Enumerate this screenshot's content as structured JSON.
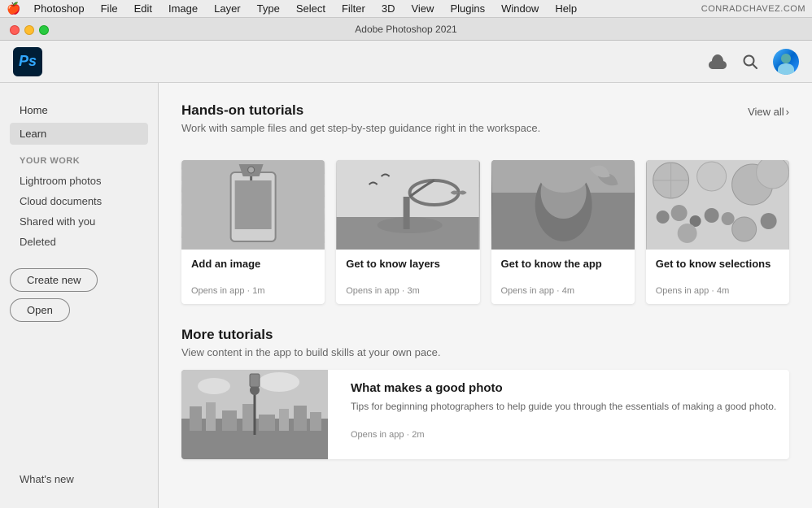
{
  "menubar": {
    "apple": "🍎",
    "app_name": "Photoshop",
    "items": [
      "File",
      "Edit",
      "Image",
      "Layer",
      "Type",
      "Select",
      "Filter",
      "3D",
      "View",
      "Plugins",
      "Window",
      "Help"
    ],
    "right_text": "CONRADCHAVEZ.COM"
  },
  "titlebar": {
    "title": "Adobe Photoshop 2021"
  },
  "header": {
    "logo_text": "Ps",
    "cloud_icon": "☁",
    "search_icon": "🔍"
  },
  "sidebar": {
    "nav_home": "Home",
    "nav_learn": "Learn",
    "your_work_label": "YOUR WORK",
    "nav_lightroom": "Lightroom photos",
    "nav_cloud": "Cloud documents",
    "nav_shared": "Shared with you",
    "nav_deleted": "Deleted",
    "btn_create": "Create new",
    "btn_open": "Open",
    "whats_new": "What's new"
  },
  "main": {
    "tutorials_title": "Hands-on tutorials",
    "tutorials_subtitle": "Work with sample files and get step-by-step guidance right in the workspace.",
    "view_all": "View all",
    "cards": [
      {
        "title": "Add an image",
        "meta": "Opens in app · 1m",
        "img_class": "card-img-1"
      },
      {
        "title": "Get to know layers",
        "meta": "Opens in app · 3m",
        "img_class": "card-img-2"
      },
      {
        "title": "Get to know the app",
        "meta": "Opens in app · 4m",
        "img_class": "card-img-3"
      },
      {
        "title": "Get to know selections",
        "meta": "Opens in app · 4m",
        "img_class": "card-img-4"
      }
    ],
    "more_title": "More tutorials",
    "more_subtitle": "View content in the app to build skills at your own pace.",
    "more_card": {
      "title": "What makes a good photo",
      "desc": "Tips for beginning photographers to help guide you through the essentials of making a good photo.",
      "meta": "Opens in app · 2m"
    }
  }
}
